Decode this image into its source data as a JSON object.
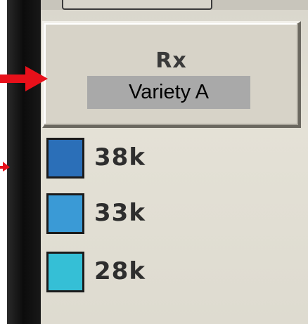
{
  "legend": {
    "button_title": "Rx",
    "variety_label": "Variety A",
    "items": [
      {
        "label": "38k",
        "color": "#2b6fb8"
      },
      {
        "label": "33k",
        "color": "#3a9ad6"
      },
      {
        "label": "28k",
        "color": "#35bfd6"
      }
    ]
  },
  "colors": {
    "arrow": "#e8101a",
    "panel": "#e0ddd2",
    "tag_background": "#a9a9a9"
  },
  "icons": [
    "arrow-right-icon",
    "arrow-right-icon"
  ]
}
